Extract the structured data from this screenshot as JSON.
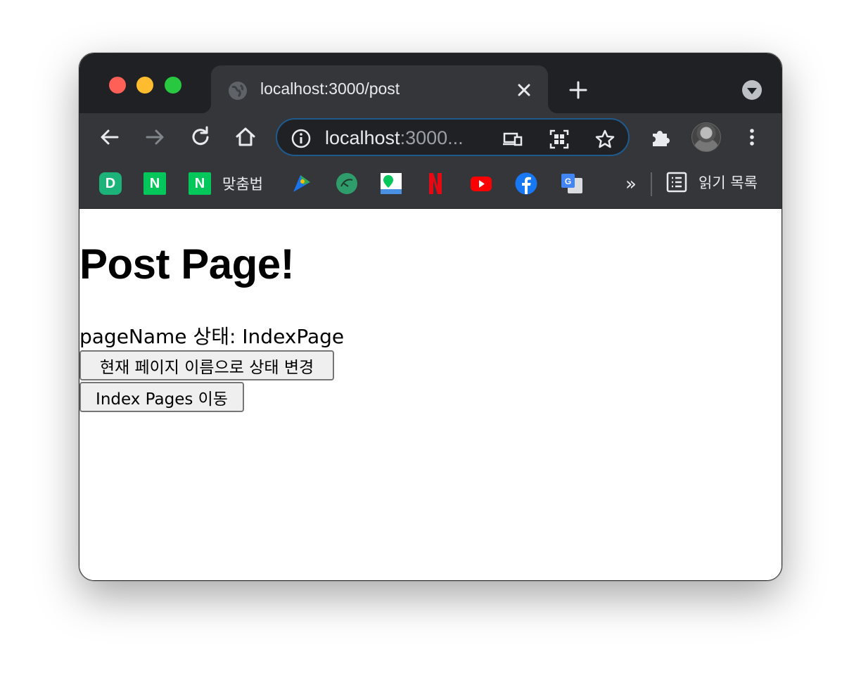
{
  "browser": {
    "tab": {
      "title": "localhost:3000/post"
    },
    "omnibox": {
      "url_host": "localhost",
      "url_rest": ":3000..."
    },
    "bookmarks": [
      {
        "name": "dcinside",
        "icon": "dcinside-icon",
        "color": "#1bb37a",
        "label": ""
      },
      {
        "name": "naver",
        "icon": "naver-icon",
        "color": "#03c75a",
        "label": ""
      },
      {
        "name": "naver-spelling",
        "icon": "naver-icon",
        "color": "#03c75a",
        "label": "맞춤법"
      },
      {
        "name": "bird-app",
        "icon": "bird-icon",
        "color": "#1a73e8",
        "label": ""
      },
      {
        "name": "green-app",
        "icon": "leaf-icon",
        "color": "#34a853",
        "label": ""
      },
      {
        "name": "naver-map",
        "icon": "map-pin-icon",
        "color": "#03c75a",
        "label": ""
      },
      {
        "name": "netflix",
        "icon": "netflix-icon",
        "color": "#e50914",
        "label": ""
      },
      {
        "name": "youtube",
        "icon": "youtube-icon",
        "color": "#ff0000",
        "label": ""
      },
      {
        "name": "facebook",
        "icon": "facebook-icon",
        "color": "#1877f2",
        "label": ""
      },
      {
        "name": "google-translate",
        "icon": "translate-icon",
        "color": "#4285f4",
        "label": ""
      }
    ],
    "more_bookmarks": "»",
    "reading_list_label": "읽기 목록"
  },
  "page": {
    "title": "Post Page!",
    "status_text": "pageName 상태: IndexPage",
    "change_button_label": "현재 페이지 이름으로 상태 변경",
    "index_button_label": "Index Pages 이동"
  },
  "colors": {
    "tabstrip": "#202124",
    "toolbar": "#35363a",
    "omnibox_border": "#1f5a8c"
  }
}
